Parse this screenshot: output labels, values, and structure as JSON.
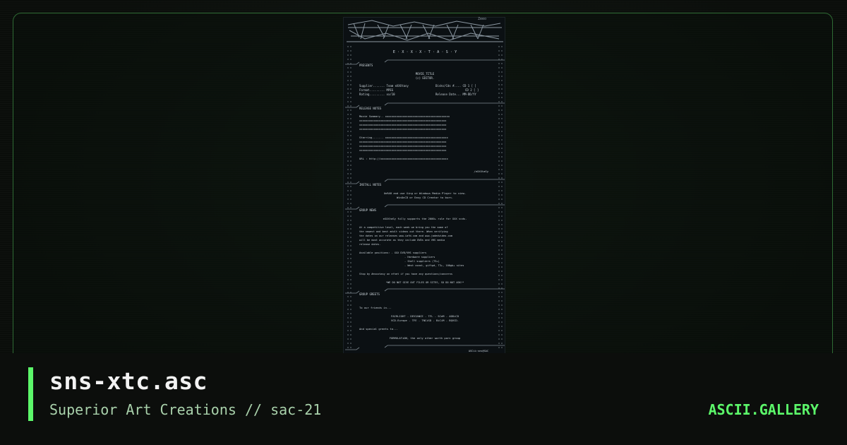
{
  "art": {
    "tag": "Zeeo",
    "lines": [
      "E · X · X · X · T · A · S · Y",
      "PRESENTS",
      "MOVIE_TITLE",
      "(c) EDITOR.",
      "Supplier....... Team eXXXtasy",
      "Disks/Cds #.... CD 1 [  ]",
      "Format......... MPEG",
      "CD 2 [  ]",
      "Rating......... xx/10",
      "Release Date... MM-DD/YY",
      "RELEASE NOTES",
      "Movie Summary.. xxxxxxxxxxxxxxxxxxxxxxxxxxxxxxxxxxxxxxxx",
      "xxxxxxxxxxxxxxxxxxxxxxxxxxxxxxxxxxxxxxxxxxxxxxxxxxxxxx",
      "xxxxxxxxxxxxxxxxxxxxxxxxxxxxxxxxxxxxxxxxxxxxxxxxxxxxxx",
      "xxxxxxxxxxxxxxxxxxxxxxxxxxxxxxxxxxxxxxxxxxxxxxxxxxxxxx",
      "Starring....... xxxxxxxxxxxxxxxxxxxxxxxxxxxxxxxxxxxxxxx",
      "xxxxxxxxxxxxxxxxxxxxxxxxxxxxxxxxxxxxxxxxxxxxxxxxxxxxxx",
      "xxxxxxxxxxxxxxxxxxxxxxxxxxxxxxxxxxxxxxxxxxxxxxxxxxxxxx",
      "xxxxxxxxxxxxxxxxxxxxxxxxxxxxxxxxxxxxxxxxxxxxxxxxxxxxxx",
      "URL : http://xxxxxxxxxxxxxxxxxxxxxxxxxxxxxxxxxxxxxxxxxx",
      "/eXXXtaSy",
      "INSTALL NOTES",
      "UnRAR and use Xing or Windows Media Player to view.",
      "WinOnCD or Easy CD Creator to burn.",
      "GROUP NEWS",
      "eXXXtaSy fully supports the 2000+ rule for XXX vcds.",
      "At a competitive level, each week we bring you the some of",
      "the newest and best adult videos out there. When verifying",
      "the dates on our releases www.iafd.com and www.jadedvideo.com",
      "will be most accurate as they include DVDs and VHS media",
      "release dates.",
      "Available positions:  - XXX DVD/VHS suppliers",
      "- Hardware suppliers",
      "- Shell suppliers (T3+)",
      "- West coast, giftpd, T3+, 100gb+ sites",
      "Stop by #exxxtasy on efnet if you have any questions/concerns",
      "*WE DO NOT GIVE OUT FILES OR SITES, SO DO NOT ASK!*",
      "GROUP GREETS",
      "To our friends in...",
      "FAIRLIGHT - DEVIANCE - TFL - SCeM - ADDiCD",
      "VCD-Europe - TFE - TNCiSD - BiCiM - BQVCD.",
      "And special greets to...",
      "FORMULATiON, the only other worth porn group",
      "ASCii:sns@SAC"
    ]
  },
  "footer": {
    "title": "sns-xtc.asc",
    "subtitle": "Superior Art Creations // sac-21",
    "brand": "ASCII.GALLERY"
  },
  "colors": {
    "accent": "#5cf76a",
    "frame": "#2f6b34",
    "art_text": "#c9d2d8"
  }
}
